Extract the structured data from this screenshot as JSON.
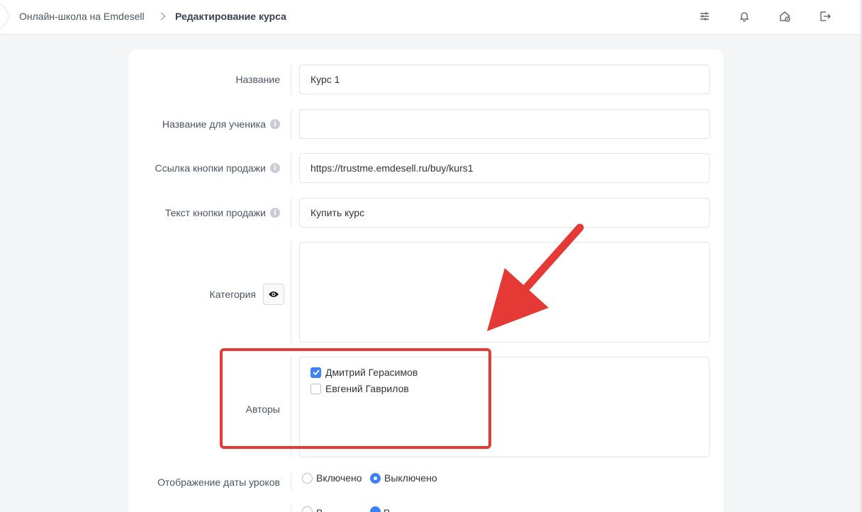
{
  "breadcrumb": {
    "home": "Онлайн-школа на Emdesell",
    "current": "Редактирование курса"
  },
  "header_icons": [
    "sliders-icon",
    "bell-icon",
    "home-settings-icon",
    "logout-icon"
  ],
  "form": {
    "name_label": "Название",
    "name_value": "Курс 1",
    "student_name_label": "Название для ученика",
    "student_name_value": "",
    "sale_link_label": "Ссылка кнопки продажи",
    "sale_link_value": "https://trustme.emdesell.ru/buy/kurs1",
    "sale_text_label": "Текст кнопки продажи",
    "sale_text_value": "Купить курс",
    "category_label": "Категория",
    "authors_label": "Авторы",
    "authors": [
      {
        "name": "Дмитрий Герасимов",
        "checked": true
      },
      {
        "name": "Евгений Гаврилов",
        "checked": false
      }
    ],
    "lesson_dates_label": "Отображение даты уроков",
    "lesson_dates_options": [
      {
        "label": "Включено",
        "selected": false
      },
      {
        "label": "Выключено",
        "selected": true
      }
    ],
    "next_row_options": [
      {
        "label": "В",
        "selected": false
      },
      {
        "label": "В",
        "selected": true
      }
    ]
  },
  "colors": {
    "accent": "#3b82f6",
    "annotation": "#e53935",
    "background": "#f4f5f7"
  }
}
